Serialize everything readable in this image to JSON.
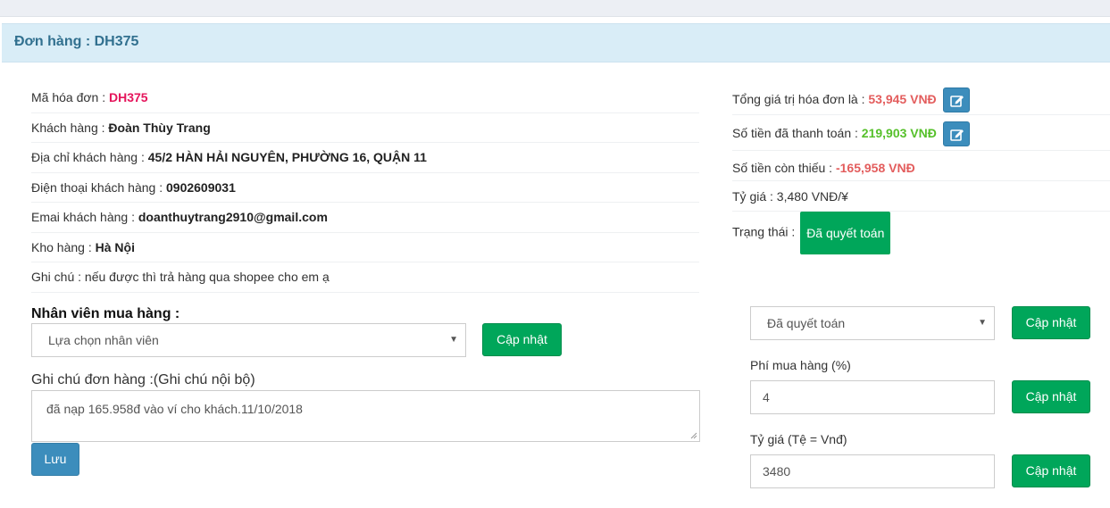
{
  "header": {
    "title": "Đơn hàng : DH375"
  },
  "order_info": {
    "invoice_code": {
      "label": "Mã hóa đơn : ",
      "value": "DH375"
    },
    "customer": {
      "label": "Khách hàng : ",
      "value": "Đoàn Thùy Trang"
    },
    "address": {
      "label": "Địa chỉ khách hàng : ",
      "value": "45/2 HÀN HẢI NGUYÊN, PHƯỜNG 16, QUẬN 11"
    },
    "phone": {
      "label": "Điện thoại khách hàng : ",
      "value": "0902609031"
    },
    "email": {
      "label": "Emai khách hàng : ",
      "value": "doanthuytrang2910@gmail.com"
    },
    "warehouse": {
      "label": "Kho hàng : ",
      "value": "Hà Nội"
    },
    "note": {
      "label": "Ghi chú : ",
      "value": "nếu được thì trả hàng qua shopee cho em ạ"
    }
  },
  "summary": {
    "total": {
      "label": "Tổng giá trị hóa đơn là : ",
      "value": "53,945 VNĐ"
    },
    "paid": {
      "label": "Số tiền đã thanh toán : ",
      "value": "219,903 VNĐ"
    },
    "remaining": {
      "label": "Số tiền còn thiếu : ",
      "value": "-165,958 VNĐ"
    },
    "rate": {
      "label": "Tỷ giá : ",
      "value": "3,480 VNĐ/¥"
    },
    "status": {
      "label": "Trạng thái : ",
      "value": "Đã quyết toán"
    }
  },
  "staff": {
    "title": "Nhân viên mua hàng :",
    "select_value": "Lựa chọn nhân viên",
    "button": "Cập nhật"
  },
  "internal_note": {
    "label": "Ghi chú đơn hàng :(Ghi chú nội bộ)",
    "value": "đã nạp 165.958đ vào ví cho khách.11/10/2018",
    "save_button": "Lưu"
  },
  "status_form": {
    "select_value": "Đã quyết toán",
    "button": "Cập nhật"
  },
  "fee_form": {
    "label": "Phí mua hàng (%)",
    "value": "4",
    "button": "Cập nhật"
  },
  "rate_form": {
    "label": "Tỷ giá (Tệ = Vnđ)",
    "value": "3480",
    "button": "Cập nhật"
  },
  "icons": {
    "edit": "edit-icon",
    "dropdown": "caret-down-icon"
  },
  "colors": {
    "accent_red": "#e5145b",
    "negative": "#e35d5d",
    "positive": "#56c02b",
    "success": "#00a65a",
    "primary": "#3c8dbc",
    "header_bg": "#d9edf7"
  }
}
